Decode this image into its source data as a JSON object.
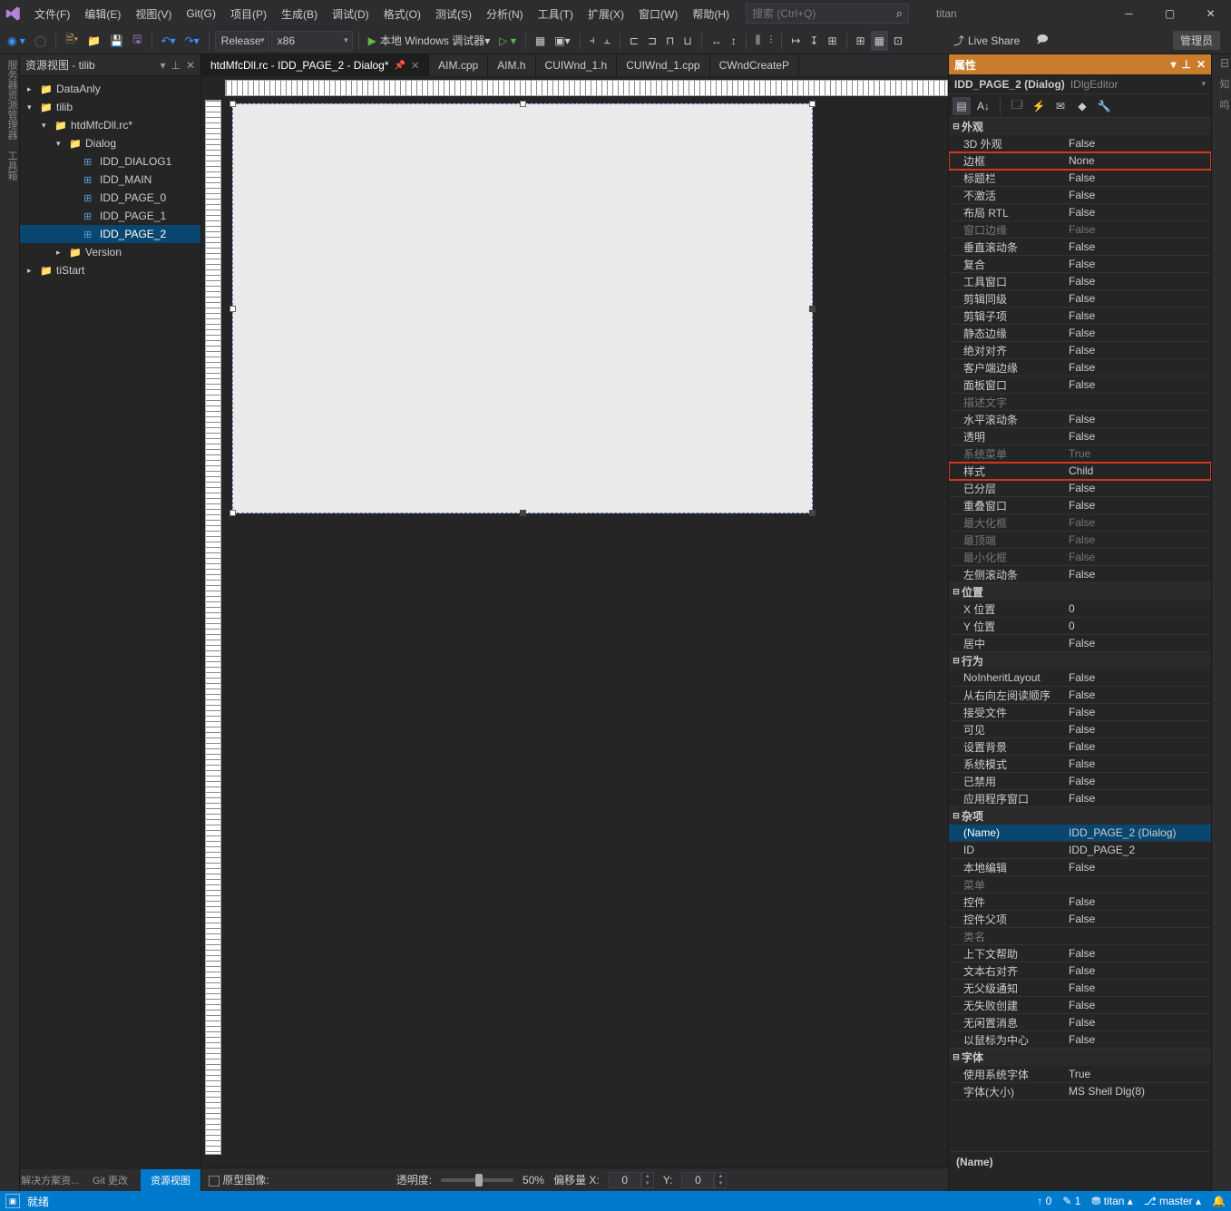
{
  "app": {
    "name": "titan"
  },
  "menu": [
    "文件(F)",
    "编辑(E)",
    "视图(V)",
    "Git(G)",
    "项目(P)",
    "生成(B)",
    "调试(D)",
    "格式(O)",
    "测试(S)",
    "分析(N)",
    "工具(T)",
    "扩展(X)",
    "窗口(W)",
    "帮助(H)"
  ],
  "search": {
    "placeholder": "搜索 (Ctrl+Q)"
  },
  "toolbar": {
    "config": "Release",
    "platform": "x86",
    "debugger": "本地 Windows 调试器",
    "liveshare": "Live Share",
    "admin": "管理员"
  },
  "resourceView": {
    "title": "资源视图 - tilib",
    "tabs": [
      "解决方案资...",
      "Git 更改",
      "资源视图"
    ],
    "tree": [
      {
        "ind": 8,
        "arrow": "▸",
        "icon": "folder",
        "label": "DataAnly"
      },
      {
        "ind": 8,
        "arrow": "▾",
        "icon": "folder",
        "label": "tilib"
      },
      {
        "ind": 24,
        "arrow": "▾",
        "icon": "folder",
        "label": "htdMfcDll.rc*"
      },
      {
        "ind": 40,
        "arrow": "▾",
        "icon": "folder",
        "label": "Dialog"
      },
      {
        "ind": 56,
        "arrow": "",
        "icon": "dlg",
        "label": "IDD_DIALOG1"
      },
      {
        "ind": 56,
        "arrow": "",
        "icon": "dlg",
        "label": "IDD_MAIN"
      },
      {
        "ind": 56,
        "arrow": "",
        "icon": "dlg",
        "label": "IDD_PAGE_0"
      },
      {
        "ind": 56,
        "arrow": "",
        "icon": "dlg",
        "label": "IDD_PAGE_1"
      },
      {
        "ind": 56,
        "arrow": "",
        "icon": "dlg",
        "label": "IDD_PAGE_2",
        "sel": true
      },
      {
        "ind": 40,
        "arrow": "▸",
        "icon": "folder",
        "label": "Version"
      },
      {
        "ind": 8,
        "arrow": "▸",
        "icon": "folder",
        "label": "tiStart"
      }
    ]
  },
  "docTabs": [
    {
      "label": "htdMfcDll.rc - IDD_PAGE_2 - Dialog*",
      "act": true,
      "pin": true,
      "close": true
    },
    {
      "label": "AIM.cpp"
    },
    {
      "label": "AIM.h"
    },
    {
      "label": "CUIWnd_1.h"
    },
    {
      "label": "CUIWnd_1.cpp"
    },
    {
      "label": "CWndCreateP"
    }
  ],
  "designerFooter": {
    "origImage": "原型图像:",
    "opacity": "透明度:",
    "opacityVal": "50%",
    "offset": "偏移量 X:",
    "offX": "0",
    "offYLabel": "Y:",
    "offY": "0"
  },
  "properties": {
    "title": "属性",
    "obj1": "IDD_PAGE_2 (Dialog)",
    "obj2": "IDlgEditor",
    "footer": "(Name)",
    "groups": [
      {
        "cat": "外观",
        "rows": [
          {
            "k": "3D 外观",
            "v": "False"
          },
          {
            "k": "边框",
            "v": "None",
            "red": true
          },
          {
            "k": "标题栏",
            "v": "False"
          },
          {
            "k": "不激活",
            "v": "False"
          },
          {
            "k": "布局 RTL",
            "v": "False"
          },
          {
            "k": "窗口边缘",
            "v": "False",
            "dim": true
          },
          {
            "k": "垂直滚动条",
            "v": "False"
          },
          {
            "k": "复合",
            "v": "False"
          },
          {
            "k": "工具窗口",
            "v": "False"
          },
          {
            "k": "剪辑同级",
            "v": "False"
          },
          {
            "k": "剪辑子项",
            "v": "False"
          },
          {
            "k": "静态边缘",
            "v": "False"
          },
          {
            "k": "绝对对齐",
            "v": "False"
          },
          {
            "k": "客户端边缘",
            "v": "False"
          },
          {
            "k": "面板窗口",
            "v": "False"
          },
          {
            "k": "描述文字",
            "v": "",
            "dim": true
          },
          {
            "k": "水平滚动条",
            "v": "False"
          },
          {
            "k": "透明",
            "v": "False"
          },
          {
            "k": "系统菜单",
            "v": "True",
            "dim": true
          },
          {
            "k": "样式",
            "v": "Child",
            "red": true
          },
          {
            "k": "已分层",
            "v": "False"
          },
          {
            "k": "重叠窗口",
            "v": "False"
          },
          {
            "k": "最大化框",
            "v": "False",
            "dim": true
          },
          {
            "k": "最顶端",
            "v": "False",
            "dim": true
          },
          {
            "k": "最小化框",
            "v": "False",
            "dim": true
          },
          {
            "k": "左侧滚动条",
            "v": "False"
          }
        ]
      },
      {
        "cat": "位置",
        "rows": [
          {
            "k": "X 位置",
            "v": "0"
          },
          {
            "k": "Y 位置",
            "v": "0"
          },
          {
            "k": "居中",
            "v": "False"
          }
        ]
      },
      {
        "cat": "行为",
        "rows": [
          {
            "k": "NoInheritLayout",
            "v": "False"
          },
          {
            "k": "从右向左阅读顺序",
            "v": "False"
          },
          {
            "k": "接受文件",
            "v": "False"
          },
          {
            "k": "可见",
            "v": "False"
          },
          {
            "k": "设置背景",
            "v": "False"
          },
          {
            "k": "系统模式",
            "v": "False"
          },
          {
            "k": "已禁用",
            "v": "False"
          },
          {
            "k": "应用程序窗口",
            "v": "False"
          }
        ]
      },
      {
        "cat": "杂项",
        "rows": [
          {
            "k": "(Name)",
            "v": "IDD_PAGE_2 (Dialog)",
            "sel": true
          },
          {
            "k": "ID",
            "v": "IDD_PAGE_2"
          },
          {
            "k": "本地编辑",
            "v": "False"
          },
          {
            "k": "菜单",
            "v": "",
            "dim": true
          },
          {
            "k": "控件",
            "v": "False"
          },
          {
            "k": "控件父项",
            "v": "False"
          },
          {
            "k": "类名",
            "v": "",
            "dim": true
          },
          {
            "k": "上下文帮助",
            "v": "False"
          },
          {
            "k": "文本右对齐",
            "v": "False"
          },
          {
            "k": "无父级通知",
            "v": "False"
          },
          {
            "k": "无失败创建",
            "v": "False"
          },
          {
            "k": "无闲置消息",
            "v": "False"
          },
          {
            "k": "以鼠标为中心",
            "v": "False"
          }
        ]
      },
      {
        "cat": "字体",
        "rows": [
          {
            "k": "使用系统字体",
            "v": "True"
          },
          {
            "k": "字体(大小)",
            "v": "MS Shell Dlg(8)"
          }
        ]
      }
    ]
  },
  "status": {
    "ready": "就绪",
    "up": "0",
    "down": "1",
    "repo": "titan",
    "branch": "master"
  },
  "leftRail": "服务器资源管理器  工具箱",
  "rightRail": "日 知 鸣"
}
